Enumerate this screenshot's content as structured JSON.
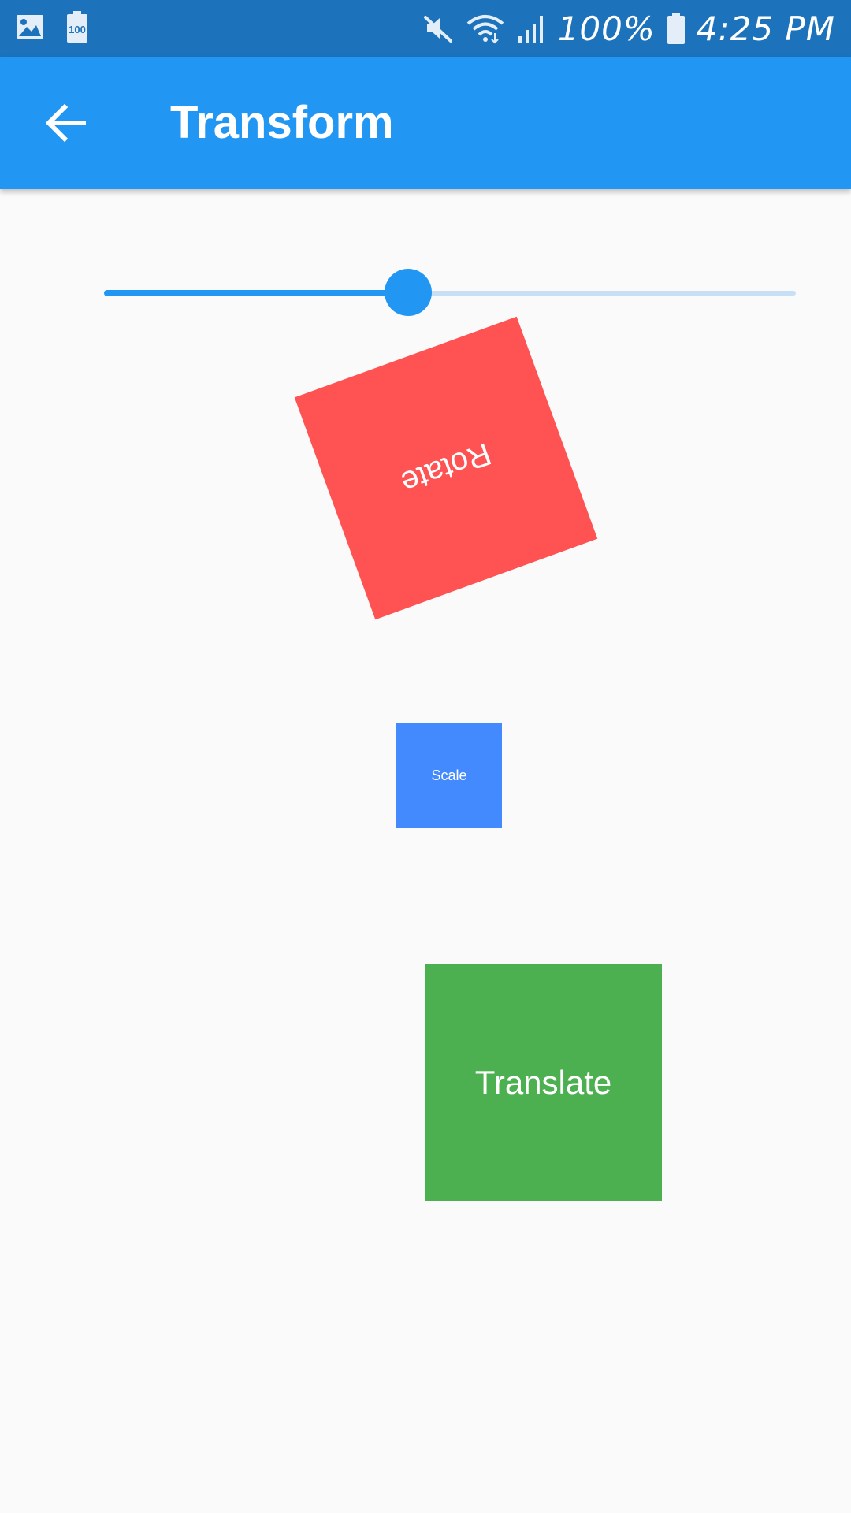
{
  "status_bar": {
    "left_icons": [
      "image-icon",
      "battery-100-icon"
    ],
    "battery_badge": "100",
    "right_icons": [
      "mute-icon",
      "wifi-icon",
      "signal-icon",
      "battery-icon"
    ],
    "battery_percent": "100%",
    "time": "4:25 PM"
  },
  "app_bar": {
    "back_icon": "arrow-back-icon",
    "title": "Transform"
  },
  "slider": {
    "value": 0.44
  },
  "boxes": {
    "rotate": {
      "label": "Rotate",
      "color": "#ff5252"
    },
    "scale": {
      "label": "Scale",
      "color": "#448aff"
    },
    "translate": {
      "label": "Translate",
      "color": "#4caf50"
    }
  },
  "colors": {
    "status_bar": "#1c73bb",
    "app_bar": "#2196f3",
    "slider_active": "#2196f3",
    "slider_inactive": "#c6e0f5",
    "background": "#fafafa"
  }
}
